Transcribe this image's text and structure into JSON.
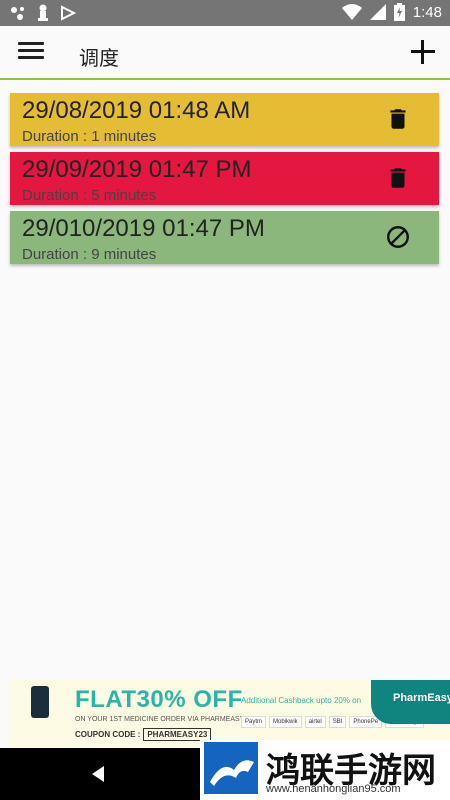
{
  "status_bar": {
    "time": "1:48",
    "icons": [
      "notification-dots-icon",
      "chess-pawn-icon",
      "play-store-icon",
      "wifi-icon",
      "signal-icon",
      "battery-charging-icon"
    ]
  },
  "app_bar": {
    "title": "调度",
    "icons": [
      "menu-icon",
      "add-icon"
    ]
  },
  "schedules": [
    {
      "datetime": "29/08/2019 01:48 AM",
      "duration": "Duration : 1 minutes",
      "color": "#e4bd34",
      "action_icon": "trash-icon"
    },
    {
      "datetime": "29/09/2019 01:47 PM",
      "duration": "Duration : 5 minutes",
      "color": "#e3173f",
      "action_icon": "trash-icon"
    },
    {
      "datetime": "29/010/2019 01:47 PM",
      "duration": "Duration : 9 minutes",
      "color": "#8bb67c",
      "action_icon": "block-icon"
    }
  ],
  "ad": {
    "headline_prefix": "FLAT",
    "headline_big": "30% OFF",
    "subline": "ON YOUR 1ST MEDICINE ORDER VIA PHARMEASY",
    "coupon_label": "COUPON CODE :",
    "coupon_code": "PHARMEASY23",
    "cashback": "Additional Cashback upto 20% on",
    "brand": "PharmEasy",
    "payments": [
      "Paytm",
      "Mobikwik",
      "airtel",
      "SBI",
      "PhonePe",
      "Freecharge"
    ]
  },
  "nav_bar": {
    "icons": [
      "back-icon"
    ]
  },
  "watermark": {
    "text": "鸿联手游网",
    "url": "www.henanhonglian95.com"
  }
}
